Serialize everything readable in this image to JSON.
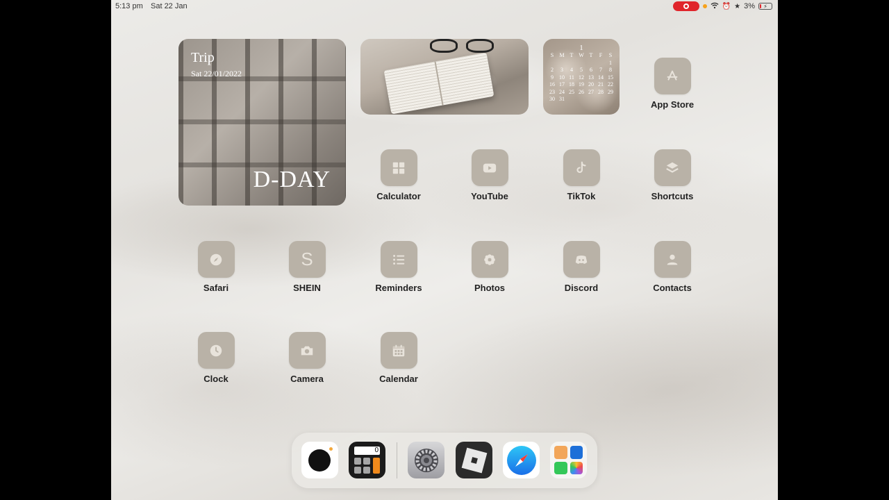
{
  "status_bar": {
    "time": "5:13 pm",
    "date": "Sat 22 Jan",
    "battery": "3%"
  },
  "widgets": {
    "trip": {
      "title": "Trip",
      "date": "Sat 22/01/2022",
      "label": "D-DAY"
    },
    "calendar": {
      "month": "1",
      "weekdays": [
        "S",
        "M",
        "T",
        "W",
        "T",
        "F",
        "S"
      ],
      "days": [
        "",
        "",
        "",
        "",
        "",
        "",
        "1",
        "2",
        "3",
        "4",
        "5",
        "6",
        "7",
        "8",
        "9",
        "10",
        "11",
        "12",
        "13",
        "14",
        "15",
        "16",
        "17",
        "18",
        "19",
        "20",
        "21",
        "22",
        "23",
        "24",
        "25",
        "26",
        "27",
        "28",
        "29",
        "30",
        "31"
      ]
    }
  },
  "apps": [
    {
      "id": "app-store",
      "label": "App Store"
    },
    {
      "id": "calculator",
      "label": "Calculator"
    },
    {
      "id": "youtube",
      "label": "YouTube"
    },
    {
      "id": "tiktok",
      "label": "TikTok"
    },
    {
      "id": "shortcuts",
      "label": "Shortcuts"
    },
    {
      "id": "safari",
      "label": "Safari"
    },
    {
      "id": "shein",
      "label": "SHEIN",
      "glyph": "S"
    },
    {
      "id": "reminders",
      "label": "Reminders"
    },
    {
      "id": "photos",
      "label": "Photos"
    },
    {
      "id": "discord",
      "label": "Discord"
    },
    {
      "id": "contacts",
      "label": "Contacts"
    },
    {
      "id": "clock",
      "label": "Clock"
    },
    {
      "id": "camera",
      "label": "Camera"
    },
    {
      "id": "calendar",
      "label": "Calendar"
    }
  ],
  "dock": {
    "calculator_display": "0",
    "items": [
      "camera-icon",
      "calculator-icon",
      "settings-icon",
      "roblox-icon",
      "safari-icon",
      "app-library-icon"
    ]
  },
  "colors": {
    "icon_tint": "#b9b2a7",
    "record": "#e0252b"
  }
}
